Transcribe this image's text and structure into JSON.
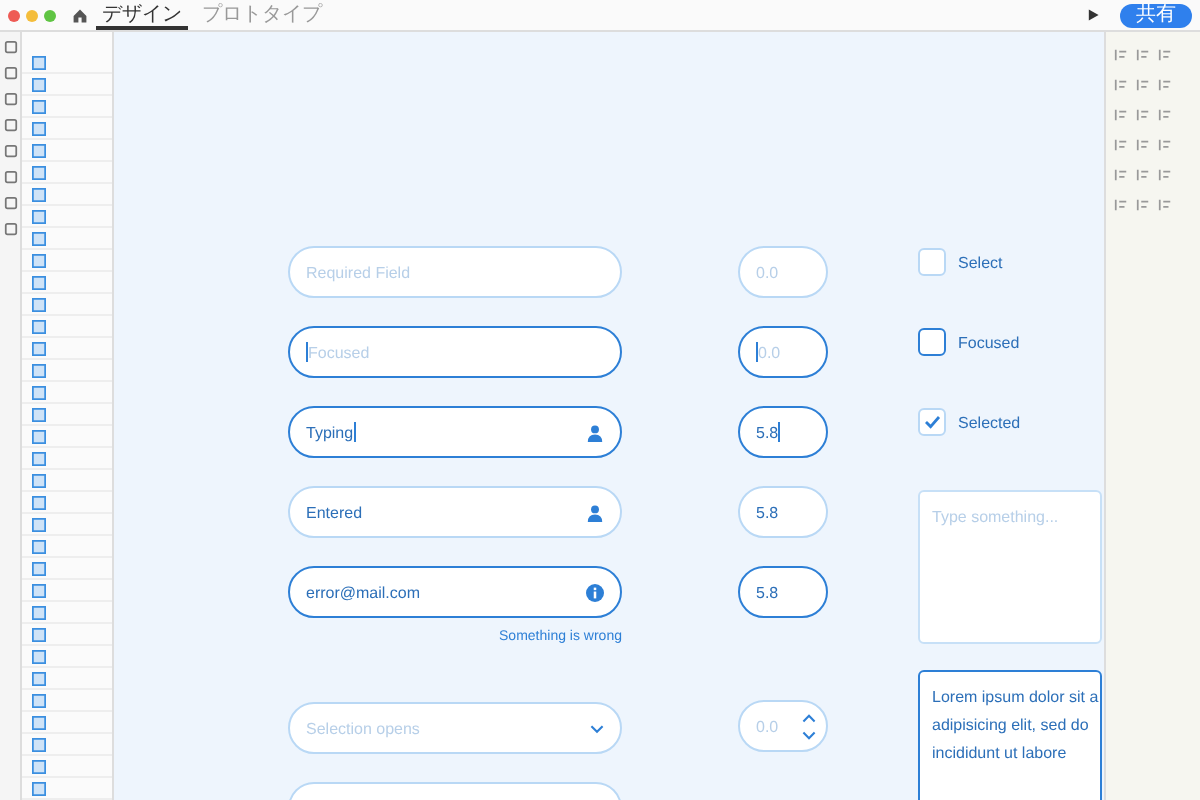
{
  "toolbar": {
    "tabs": [
      {
        "label": "デザイン",
        "selected": true
      },
      {
        "label": "プロトタイプ",
        "selected": false
      }
    ],
    "share_button": "共有"
  },
  "fields": [
    {
      "kind": "placeholder",
      "placeholder": "Required Field"
    },
    {
      "kind": "focused",
      "placeholder": "Focused"
    },
    {
      "kind": "typing",
      "value": "Typing"
    },
    {
      "kind": "entered",
      "value": "Entered"
    },
    {
      "kind": "error",
      "value": "error@mail.com",
      "message": "Something is wrong"
    }
  ],
  "number_fields": [
    {
      "kind": "placeholder",
      "placeholder": "0.0"
    },
    {
      "kind": "focused",
      "placeholder": "0.0"
    },
    {
      "kind": "typing",
      "value": "5.8"
    },
    {
      "kind": "entered",
      "value": "5.8"
    },
    {
      "kind": "error",
      "value": "5.8"
    }
  ],
  "checkboxes": [
    {
      "label": "Select",
      "checked": false,
      "kind": "default"
    },
    {
      "label": "Focused",
      "checked": false,
      "kind": "focused"
    },
    {
      "label": "Selected",
      "checked": true,
      "kind": "default"
    }
  ],
  "textareas": [
    {
      "placeholder": "Type something...",
      "focused": false
    },
    {
      "lines": [
        "Lorem ipsum dolor sit a",
        "adipisicing elit, sed do",
        "incididunt ut labore"
      ],
      "focused": true
    }
  ],
  "select": {
    "placeholder": "Selection opens"
  },
  "stepper": {
    "placeholder": "0.0"
  }
}
